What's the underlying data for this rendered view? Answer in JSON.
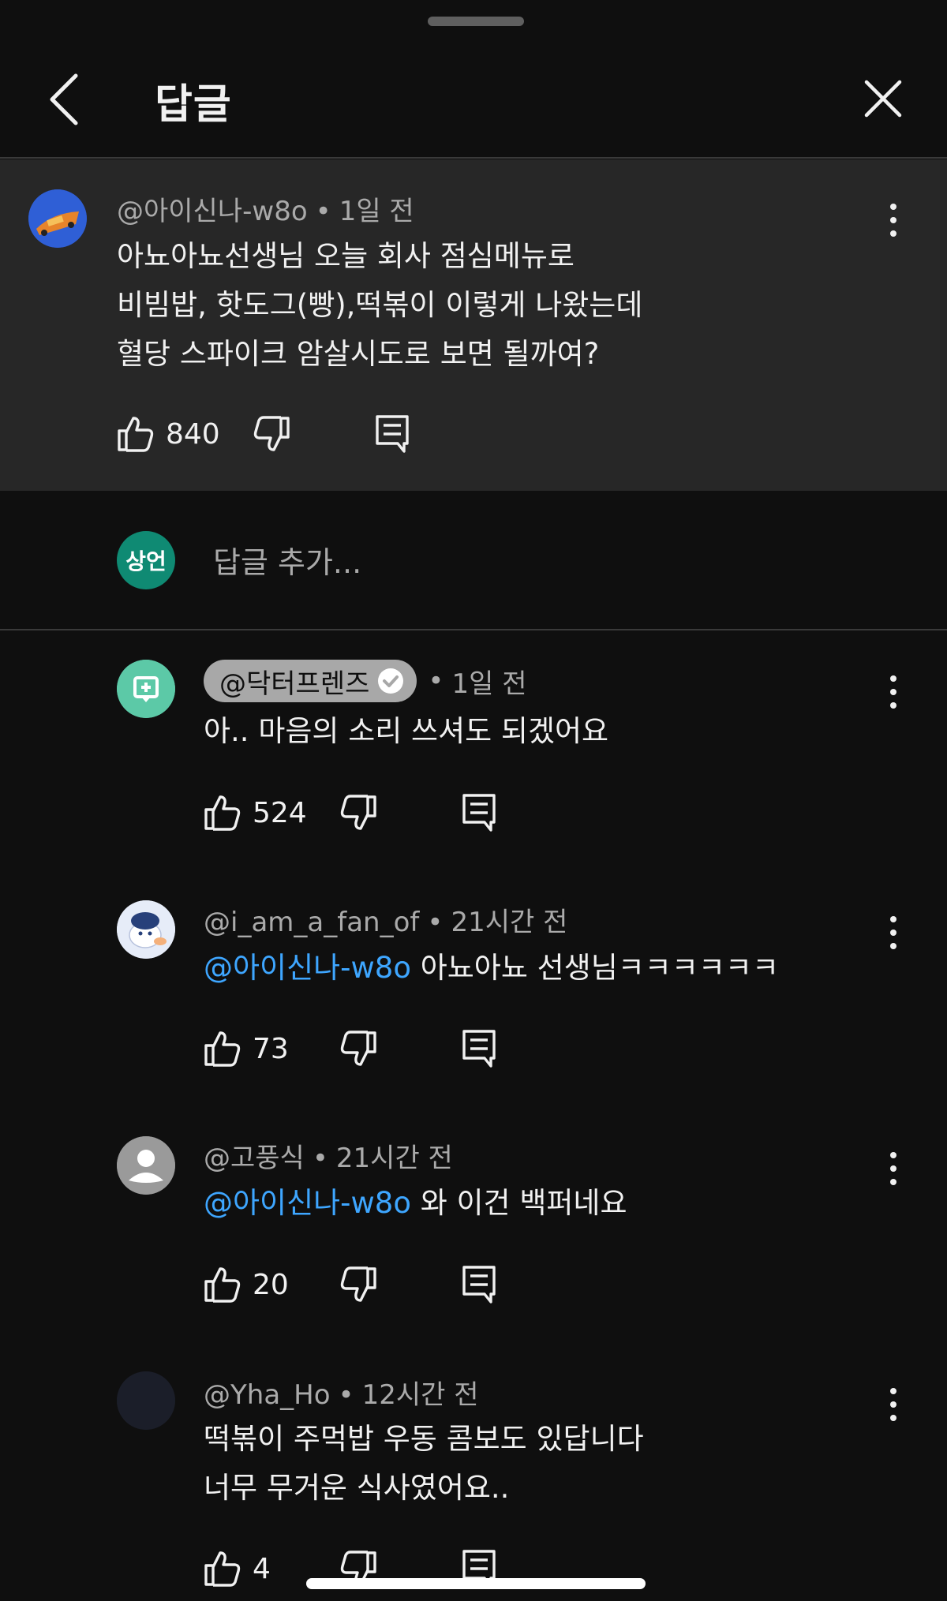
{
  "header": {
    "title": "답글"
  },
  "parent_comment": {
    "author": "@아이신나-w8o",
    "time": "1일 전",
    "lines": [
      "아뇨아뇨선생님 오늘 회사 점심메뉴로",
      "비빔밥, 핫도그(빵),떡볶이 이렇게 나왔는데",
      "혈당 스파이크 암살시도로 보면 될까여?"
    ],
    "likes": "840"
  },
  "composer": {
    "avatar_text": "상언",
    "placeholder": "답글 추가..."
  },
  "replies": [
    {
      "author": "@닥터프렌즈",
      "time": "1일 전",
      "mention": "",
      "text": "아.. 마음의 소리 쓰셔도 되겠어요",
      "likes": "524"
    },
    {
      "author": "@i_am_a_fan_of",
      "time": "21시간 전",
      "mention": "@아이신나-w8o",
      "text": " 아뇨아뇨 선생님ㅋㅋㅋㅋㅋㅋ",
      "likes": "73"
    },
    {
      "author": "@고풍식",
      "time": "21시간 전",
      "mention": "@아이신나-w8o",
      "text": " 와 이건 백퍼네요",
      "likes": "20"
    },
    {
      "author": "@Yha_Ho",
      "time": "12시간 전",
      "mention": "",
      "text": "떡볶이 주먹밥 우동 콤보도 있답니다",
      "text2": "너무 무거운 식사였어요..",
      "likes": "4"
    }
  ],
  "colors": {
    "background": "#0f0f0f",
    "highlight": "#272727",
    "mention": "#3ea6ff",
    "composer_avatar": "#0f8a73",
    "channel_avatar": "#5cc9a7"
  },
  "icons": [
    "chevron-left-icon",
    "close-icon",
    "more-vert-icon",
    "thumb-up-icon",
    "thumb-down-icon",
    "reply-icon",
    "verified-check-icon"
  ]
}
